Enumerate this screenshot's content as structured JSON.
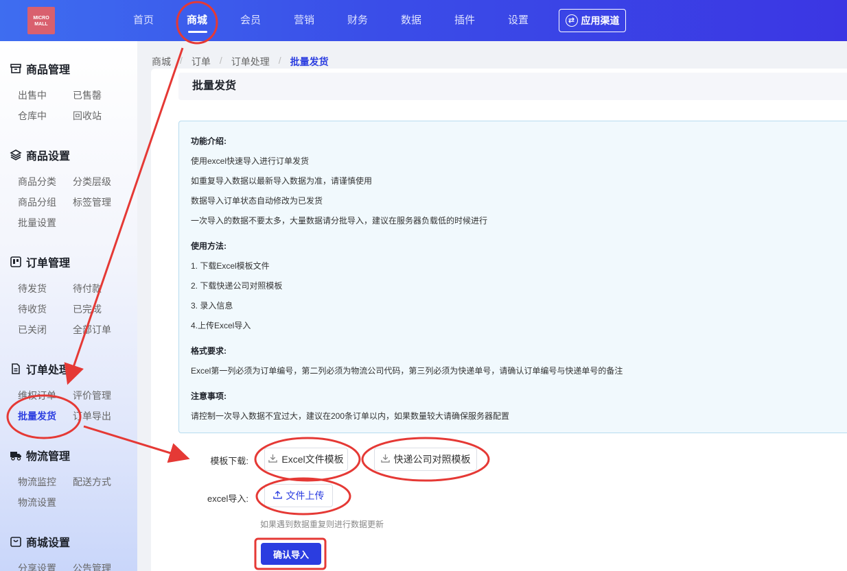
{
  "app": {
    "logo_text_1": "MICRO",
    "logo_text_2": "MALL"
  },
  "nav": {
    "items": [
      "首页",
      "商城",
      "会员",
      "营销",
      "财务",
      "数据",
      "插件",
      "设置"
    ],
    "active": "商城",
    "channel_button": "应用渠道"
  },
  "sidebar": {
    "sections": [
      {
        "title": "商品管理",
        "icon": "box-icon",
        "items": [
          "出售中",
          "已售罄",
          "仓库中",
          "回收站"
        ]
      },
      {
        "title": "商品设置",
        "icon": "layers-icon",
        "items": [
          "商品分类",
          "分类层级",
          "商品分组",
          "标签管理",
          "批量设置"
        ]
      },
      {
        "title": "订单管理",
        "icon": "order-icon",
        "items": [
          "待发货",
          "待付款",
          "待收货",
          "已完成",
          "已关闭",
          "全部订单"
        ]
      },
      {
        "title": "订单处理",
        "icon": "document-icon",
        "items": [
          "维权订单",
          "评价管理",
          "批量发货",
          "订单导出"
        ]
      },
      {
        "title": "物流管理",
        "icon": "truck-icon",
        "items": [
          "物流监控",
          "配送方式",
          "物流设置"
        ]
      },
      {
        "title": "商城设置",
        "icon": "bag-icon",
        "items": [
          "分享设置",
          "公告管理"
        ]
      }
    ],
    "active_item": "批量发货"
  },
  "breadcrumb": [
    "商城",
    "订单",
    "订单处理",
    "批量发货"
  ],
  "page_title": "批量发货",
  "info": {
    "intro_title": "功能介绍:",
    "intro_lines": [
      "使用excel快速导入进行订单发货",
      "如重复导入数据以最新导入数据为准，请谨慎使用",
      "数据导入订单状态自动修改为已发货",
      "一次导入的数据不要太多，大量数据请分批导入，建议在服务器负载低的时候进行"
    ],
    "usage_title": "使用方法:",
    "usage_lines": [
      "1. 下载Excel模板文件",
      "2. 下载快递公司对照模板",
      "3. 录入信息",
      "4.上传Excel导入"
    ],
    "format_title": "格式要求:",
    "format_line": "Excel第一列必须为订单编号，第二列必须为物流公司代码，第三列必须为快递单号，请确认订单编号与快递单号的备注",
    "notice_title": "注意事项:",
    "notice_line": "请控制一次导入数据不宜过大，建议在200条订单以内，如果数量较大请确保服务器配置"
  },
  "form": {
    "template_label": "模板下载:",
    "excel_template_button": "Excel文件模板",
    "express_template_button": "快递公司对照模板",
    "import_label": "excel导入:",
    "upload_button": "文件上传",
    "hint": "如果遇到数据重复则进行数据更新",
    "confirm_button": "确认导入"
  },
  "colors": {
    "primary": "#2b3de0",
    "annotation": "#e53935"
  }
}
